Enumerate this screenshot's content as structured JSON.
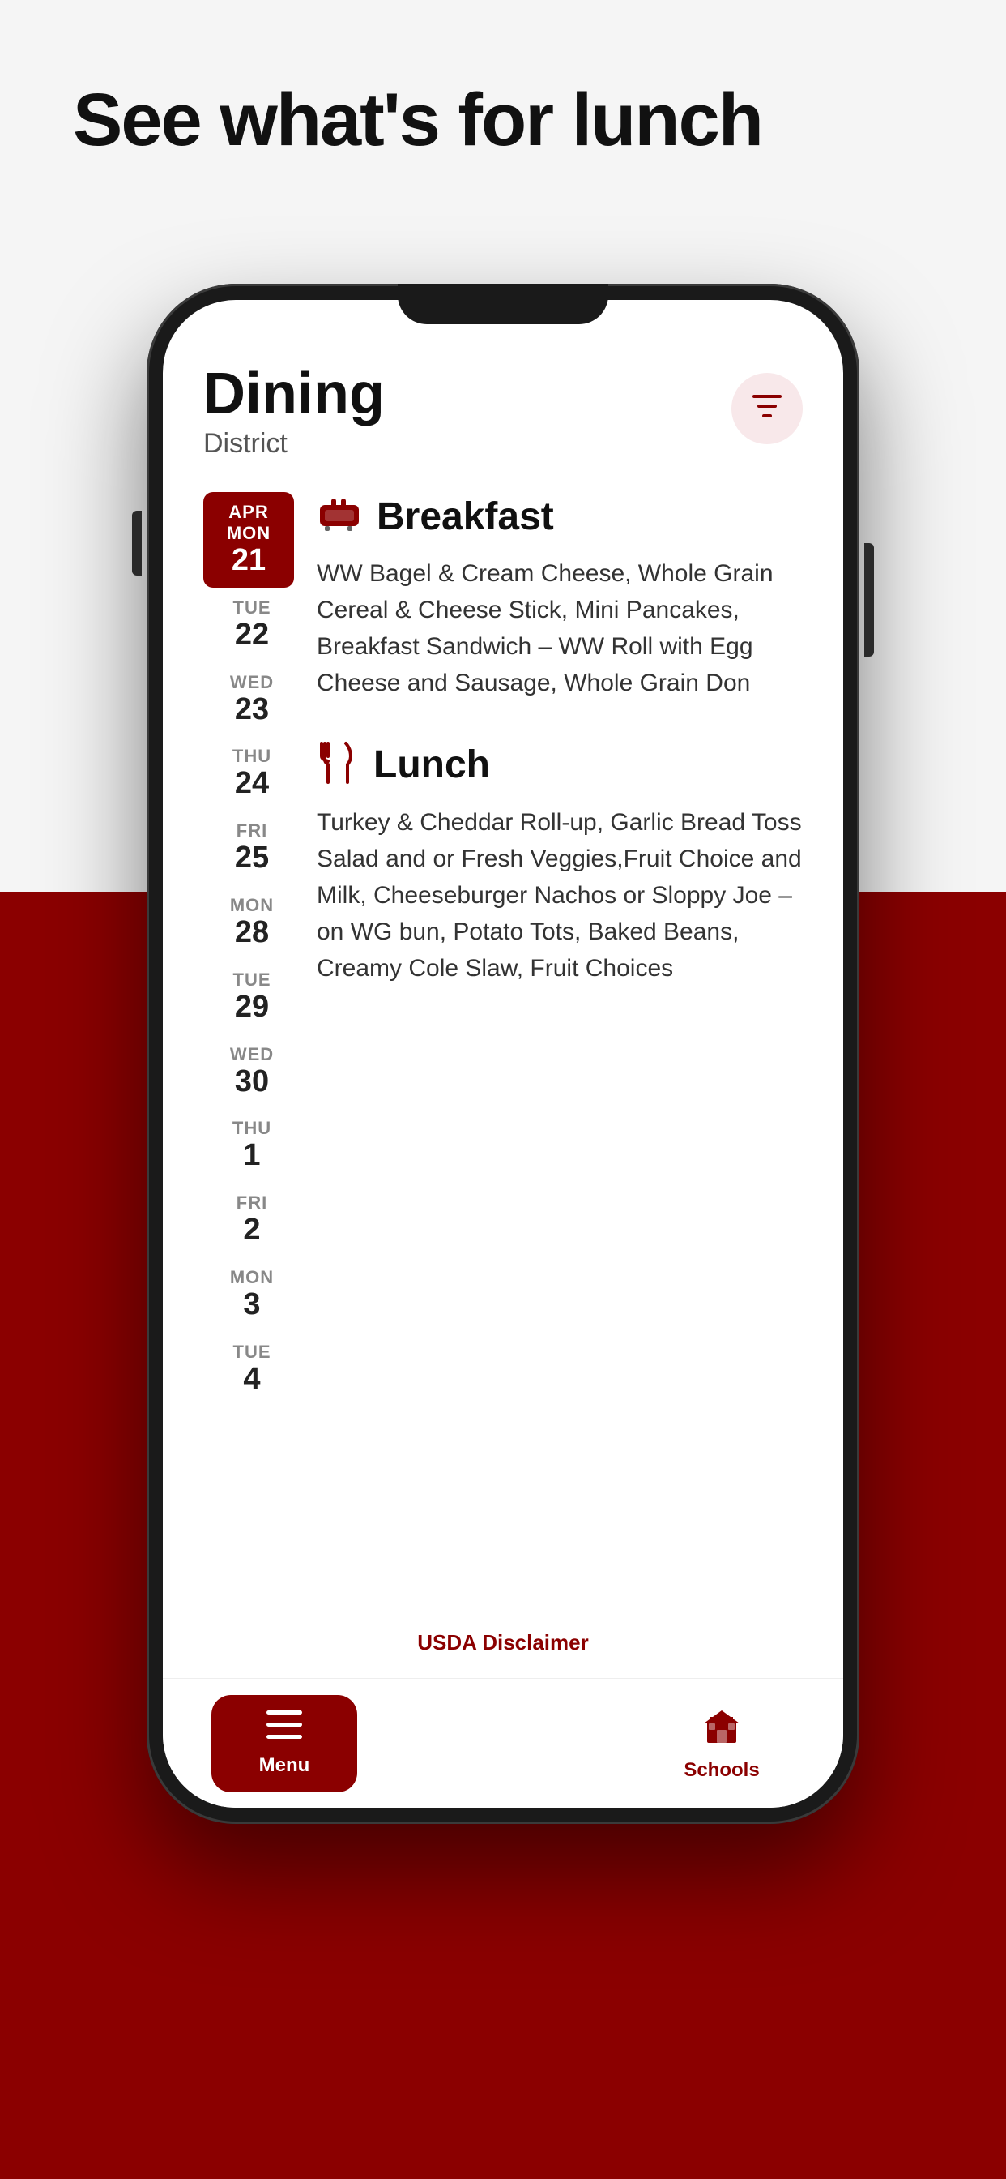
{
  "page": {
    "background_top": "#f5f5f5",
    "background_bottom": "#8B0000",
    "headline": "See what's for lunch"
  },
  "app": {
    "title": "Dining",
    "subtitle": "District"
  },
  "filter_button": {
    "label": "filter"
  },
  "dates": [
    {
      "day": "Apr",
      "label": "MON",
      "number": "21",
      "active": true
    },
    {
      "day": "",
      "label": "TUE",
      "number": "22",
      "active": false
    },
    {
      "day": "",
      "label": "WED",
      "number": "23",
      "active": false
    },
    {
      "day": "",
      "label": "THU",
      "number": "24",
      "active": false
    },
    {
      "day": "",
      "label": "FRI",
      "number": "25",
      "active": false
    },
    {
      "day": "",
      "label": "MON",
      "number": "28",
      "active": false
    },
    {
      "day": "",
      "label": "TUE",
      "number": "29",
      "active": false
    },
    {
      "day": "",
      "label": "WED",
      "number": "30",
      "active": false
    },
    {
      "day": "",
      "label": "THU",
      "number": "1",
      "active": false
    },
    {
      "day": "",
      "label": "FRI",
      "number": "2",
      "active": false
    },
    {
      "day": "",
      "label": "MON",
      "number": "3",
      "active": false
    },
    {
      "day": "",
      "label": "TUE",
      "number": "4",
      "active": false
    }
  ],
  "meals": {
    "breakfast": {
      "title": "Breakfast",
      "icon": "🍳",
      "description": "WW Bagel & Cream Cheese, Whole Grain Cereal & Cheese Stick, Mini Pancakes, Breakfast Sandwich – WW Roll with Egg Cheese and Sausage, Whole Grain Don"
    },
    "lunch": {
      "title": "Lunch",
      "icon": "🍴",
      "description": "Turkey & Cheddar Roll-up, Garlic Bread Toss Salad and or Fresh Veggies,Fruit Choice and Milk, Cheeseburger Nachos or Sloppy Joe – on WG bun, Potato Tots, Baked Beans, Creamy Cole Slaw, Fruit Choices"
    }
  },
  "bottom_bar": {
    "usda_disclaimer": "USDA Disclaimer",
    "tabs": [
      {
        "id": "menu",
        "label": "Menu",
        "icon": "menu",
        "active": true
      },
      {
        "id": "schools",
        "label": "Schools",
        "icon": "school",
        "active": false
      }
    ]
  }
}
